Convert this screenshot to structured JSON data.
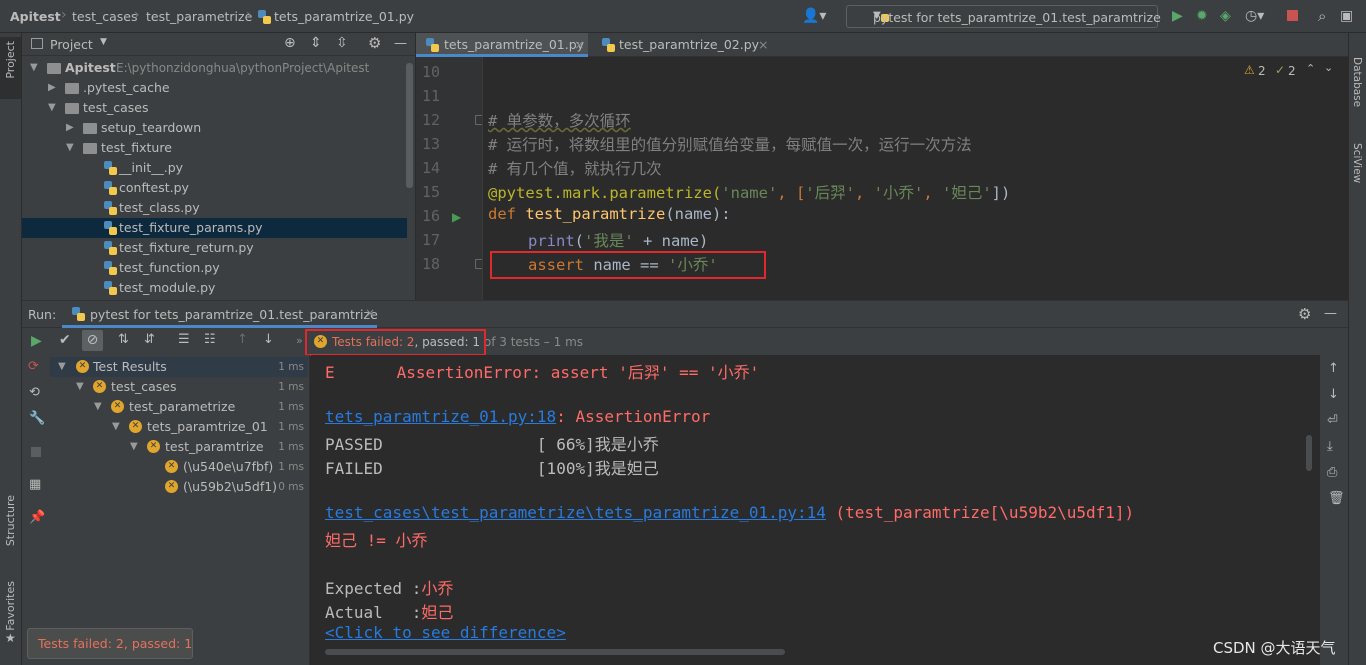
{
  "navbar": {
    "crumbs": [
      "Apitest",
      "test_cases",
      "test_parametrize",
      "tets_paramtrize_01.py"
    ],
    "run_config": "pytest for tets_paramtrize_01.test_paramtrize"
  },
  "left_strip": {
    "project": "Project",
    "structure": "Structure",
    "favorites": "Favorites"
  },
  "right_strip": {
    "database": "Database",
    "sciview": "SciView"
  },
  "project_panel": {
    "title": "Project",
    "root_name": "Apitest",
    "root_path": "E:\\pythonzidonghua\\pythonProject\\Apitest",
    "items": [
      {
        "label": ".pytest_cache"
      },
      {
        "label": "test_cases"
      },
      {
        "label": "setup_teardown"
      },
      {
        "label": "test_fixture"
      },
      {
        "label": "__init__.py"
      },
      {
        "label": "conftest.py"
      },
      {
        "label": "test_class.py"
      },
      {
        "label": "test_fixture_params.py"
      },
      {
        "label": "test_fixture_return.py"
      },
      {
        "label": "test_function.py"
      },
      {
        "label": "test_module.py"
      }
    ]
  },
  "editor": {
    "tabs": [
      {
        "label": "tets_paramtrize_01.py"
      },
      {
        "label": "test_paramtrize_02.py"
      }
    ],
    "warnings_count": "2",
    "weak_warnings_count": "2",
    "line_numbers": [
      "10",
      "11",
      "12",
      "13",
      "14",
      "15",
      "16",
      "17",
      "18"
    ],
    "code": {
      "l12": "# 单参数，多次循环",
      "l13": "# 运行时，将数组里的值分别赋值给变量，每赋值一次，运行一次方法",
      "l14": "# 有几个值，就执行几次",
      "l15_deco": "@pytest.mark.parametrize(",
      "l15_s1": "'name'",
      "l15_c1": ", [",
      "l15_s2": "'后羿'",
      "l15_c2": ", ",
      "l15_s3": "'小乔'",
      "l15_c3": ", ",
      "l15_s4": "'妲己'",
      "l15_end": "])",
      "l16_kw": "def ",
      "l16_fn": "test_paramtrize",
      "l16_rest": "(name):",
      "l17_fn": "print",
      "l17_a": "(",
      "l17_str": "'我是'",
      "l17_b": " + name)",
      "l18_kw": "assert",
      "l18_mid": " name == ",
      "l18_str": "'小乔'"
    }
  },
  "run_panel": {
    "label": "Run:",
    "tab": "pytest for tets_paramtrize_01.test_paramtrize",
    "status_failed": "Tests failed: 2",
    "status_passed": ", passed: 1",
    "status_rest": " of 3 tests – 1 ms",
    "tree": [
      {
        "label": "Test Results",
        "dur": "1 ms"
      },
      {
        "label": "test_cases",
        "dur": "1 ms"
      },
      {
        "label": "test_parametrize",
        "dur": "1 ms"
      },
      {
        "label": "tets_paramtrize_01",
        "dur": "1 ms"
      },
      {
        "label": "test_paramtrize",
        "dur": "1 ms"
      },
      {
        "label": "(\\u540e\\u7fbf)",
        "dur": "1 ms"
      },
      {
        "label": "(\\u59b2\\u5df1)",
        "dur": "0 ms"
      }
    ],
    "console": {
      "l1_e": "E",
      "l1_msg": "AssertionError: assert '后羿' == '小乔'",
      "l2_link": "tets_paramtrize_01.py:18",
      "l2_rest": ": AssertionError",
      "l3": "PASSED                [ 66%]我是小乔",
      "l4": "FAILED                [100%]我是妲己",
      "l5_link": "test_cases\\test_parametrize\\tets_paramtrize_01.py:14",
      "l5_rest": " (test_paramtrize[\\u59b2\\u5df1])",
      "l6": "妲己 != 小乔",
      "l7_label": "Expected :",
      "l7_val": "小乔",
      "l8_label": "Actual   :",
      "l8_val": "妲己",
      "l9_link": "<Click to see difference>"
    }
  },
  "tooltip": "Tests failed: 2, passed: 1",
  "watermark": "CSDN @大语天气"
}
